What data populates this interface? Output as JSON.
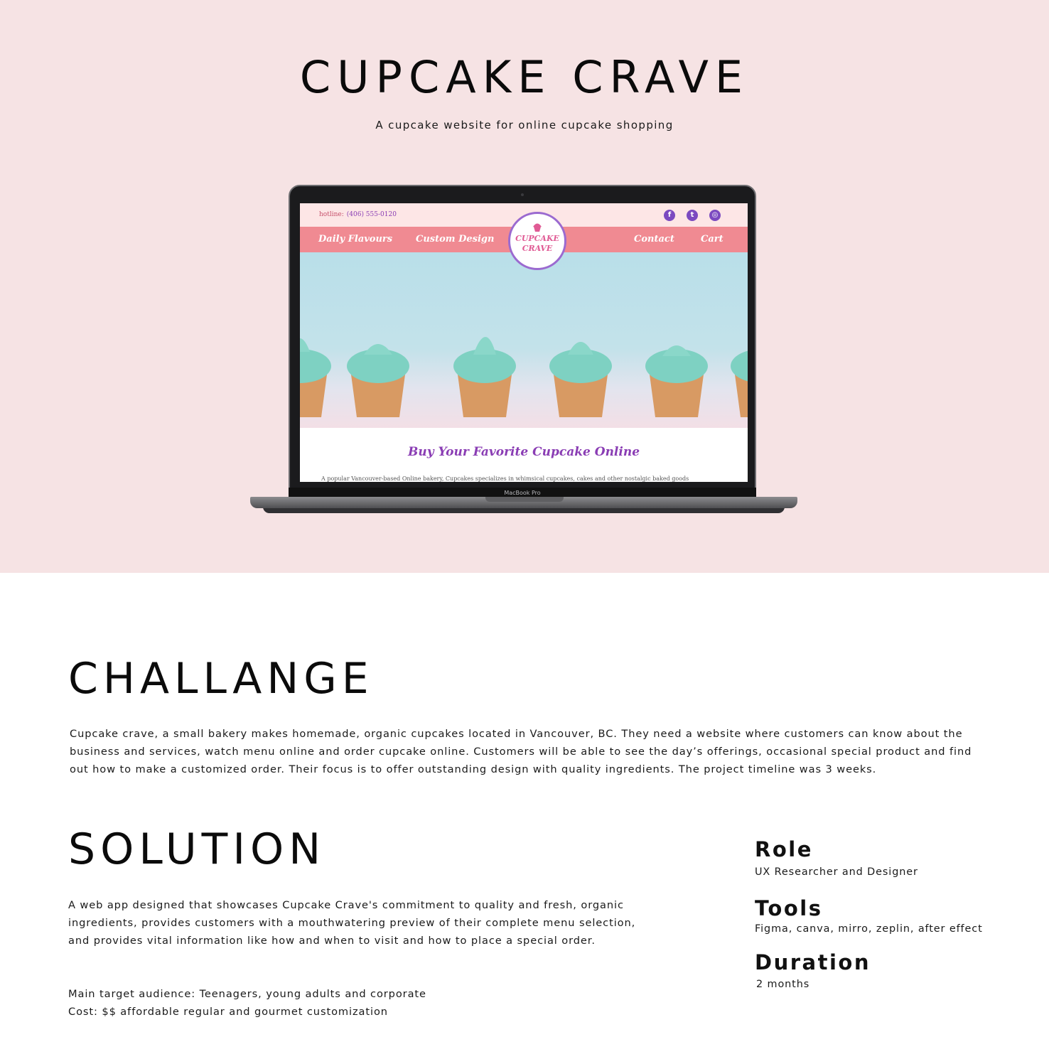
{
  "hero": {
    "title": "CUPCAKE CRAVE",
    "subtitle": "A cupcake website for online cupcake shopping",
    "background": "#f6e3e4"
  },
  "mockup": {
    "device_label": "MacBook Pro",
    "site": {
      "hotline_label": "hotline:",
      "hotline_number": "(406) 555-0120",
      "social_icons": [
        "facebook-icon",
        "twitter-icon",
        "instagram-icon"
      ],
      "nav": [
        "Daily Flavours",
        "Custom Design",
        "Contact",
        "Cart"
      ],
      "logo_line1": "CUPCAKE",
      "logo_line2": "CRAVE",
      "heading": "Buy Your Favorite Cupcake Online",
      "body": "A popular Vancouver-based Online bakery, Cupcakes specializes in whimsical cupcakes, cakes and other nostalgic baked goods",
      "nav_color": "#f08a92",
      "accent_color": "#8a3db4"
    }
  },
  "challenge": {
    "title": "CHALLANGE",
    "text": "Cupcake crave, a small bakery makes homemade, organic cupcakes located in Vancouver, BC. They need a website where customers can know about the business and services,  watch menu online and order cupcake online. Customers will be able to see the day’s offerings, occasional special product and find out how to make a customized order. Their focus  is to offer outstanding design with quality ingredients. The project timeline was 3 weeks."
  },
  "solution": {
    "title": "SOLUTION",
    "text": "A web app designed that showcases Cupcake Crave's commitment to quality and fresh, organic ingredients, provides customers with a mouthwatering preview of their complete menu selection, and provides vital information like how and when to visit and how to place a special order.",
    "audience": "Main target audience: Teenagers, young adults and corporate",
    "cost": "Cost: $$ affordable regular and gourmet customization"
  },
  "details": {
    "role_label": "Role",
    "role_value": "UX Researcher and Designer",
    "tools_label": "Tools",
    "tools_value": "Figma, canva, mirro, zeplin, after effect",
    "duration_label": "Duration",
    "duration_value": "2 months"
  }
}
